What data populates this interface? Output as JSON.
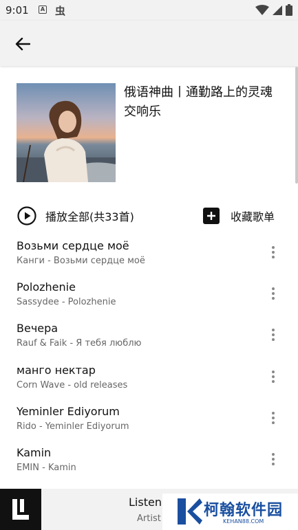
{
  "status_bar": {
    "time": "9:01",
    "a_icon": "A",
    "app_icon_text": "虫"
  },
  "header": {
    "back_icon": "arrow-left-icon"
  },
  "playlist": {
    "title": "俄语神曲丨通勤路上的灵魂交响乐"
  },
  "actions": {
    "play_all": "播放全部(共33首)",
    "collect": "收藏歌单"
  },
  "songs": [
    {
      "title": "Возьми сердце моё",
      "subtitle": "Канги - Возьми сердце моё"
    },
    {
      "title": "Polozhenie",
      "subtitle": "Sassydee - Polozhenie"
    },
    {
      "title": "Вечера",
      "subtitle": "Rauf & Faik - Я тебя люблю"
    },
    {
      "title": "манго нектар",
      "subtitle": "Corn Wave - old releases"
    },
    {
      "title": "Yeminler Ediyorum",
      "subtitle": "Rido - Yeminler Ediyorum"
    },
    {
      "title": "Kamin",
      "subtitle": "EMIN - Kamin"
    }
  ],
  "player": {
    "title": "Listen",
    "artist": "Artist"
  },
  "watermark": {
    "name": "柯翰软件园",
    "url": "KEHAN88.COM"
  },
  "colors": {
    "background": "#ffffff",
    "bar": "#f2f2f2",
    "watermark": "#1a4fa0"
  }
}
